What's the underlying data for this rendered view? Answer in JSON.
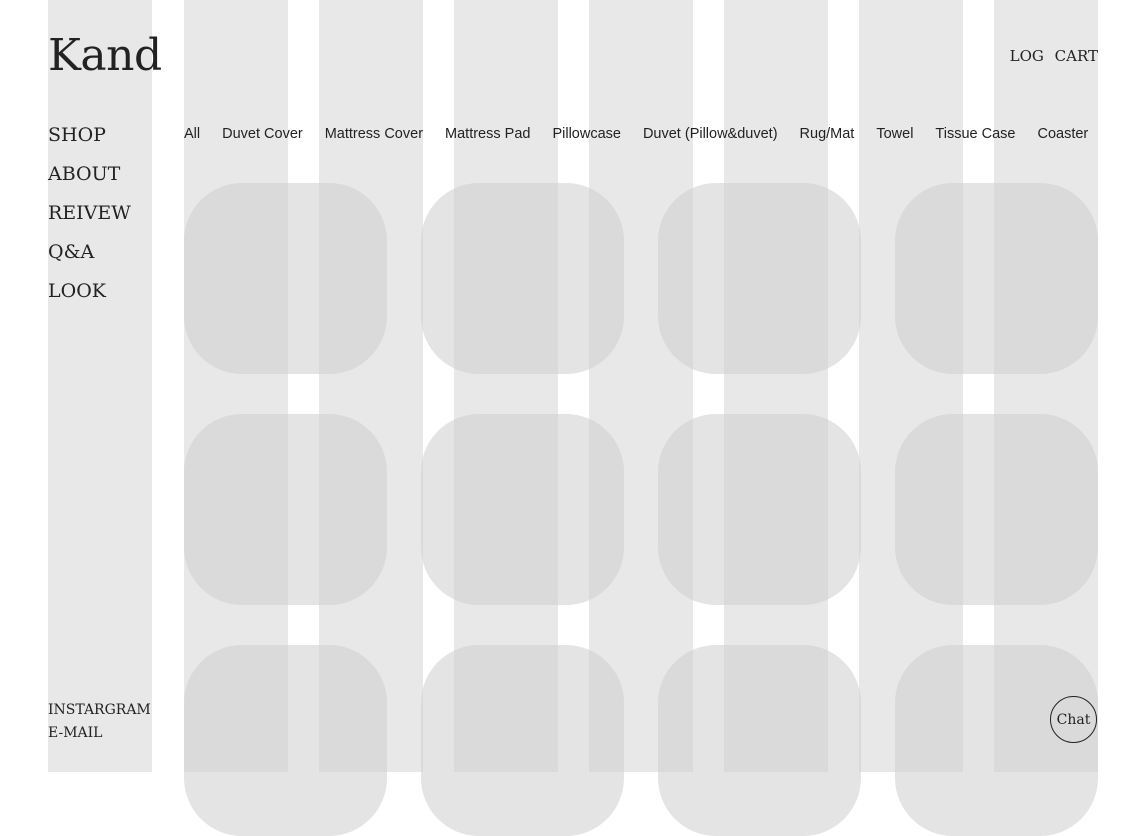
{
  "brand": {
    "logo": "Kand"
  },
  "header": {
    "login_label": "LOG",
    "cart_label": "CART"
  },
  "side_nav": {
    "items": [
      {
        "label": "SHOP"
      },
      {
        "label": "ABOUT"
      },
      {
        "label": "REIVEW"
      },
      {
        "label": "Q&A"
      },
      {
        "label": "LOOK"
      }
    ]
  },
  "side_footer": {
    "instagram_label": "INSTARGRAM",
    "email_label": "E-MAIL"
  },
  "categories": {
    "items": [
      {
        "label": "All"
      },
      {
        "label": "Duvet Cover"
      },
      {
        "label": "Mattress Cover"
      },
      {
        "label": "Mattress Pad"
      },
      {
        "label": "Pillowcase"
      },
      {
        "label": "Duvet (Pillow&duvet)"
      },
      {
        "label": "Rug/Mat"
      },
      {
        "label": "Towel"
      },
      {
        "label": "Tissue Case"
      },
      {
        "label": "Coaster"
      }
    ]
  },
  "chat": {
    "label": "Chat"
  },
  "colors": {
    "background": "#ffffff",
    "text": "#222222",
    "column_overlay": "#e6e6e6",
    "card_placeholder": "#d6d6d6"
  }
}
